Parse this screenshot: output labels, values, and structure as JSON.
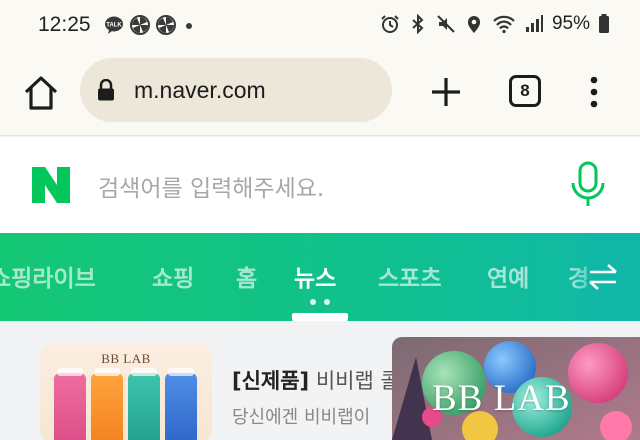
{
  "status_bar": {
    "time": "12:25",
    "left_icons": [
      "talk-icon",
      "pinwheel-icon",
      "pinwheel-icon",
      "dot-icon"
    ],
    "right_icons": [
      "alarm-icon",
      "bluetooth-icon",
      "mute-icon",
      "location-icon",
      "wifi-icon",
      "signal-icon",
      "battery-icon"
    ],
    "battery": "95%"
  },
  "browser": {
    "url": "m.naver.com",
    "tab_count": "8"
  },
  "search": {
    "logo": "N",
    "placeholder": "검색어를 입력해주세요."
  },
  "nav": {
    "items": [
      "쇼핑라이브",
      "쇼핑",
      "홈",
      "뉴스",
      "스포츠",
      "연예",
      "경"
    ],
    "active": "뉴스"
  },
  "content": {
    "thumb_brand": "BB LAB",
    "ad_prefix": "[신제품]",
    "ad_title_rest": " 비비랩 콜",
    "ad_desc": "당신에겐 비비랩이",
    "banner_text": "BB LAB"
  },
  "colors": {
    "naver_green": "#03c75a",
    "nav_gradient_start": "#14c774",
    "nav_gradient_end": "#11b8a8"
  }
}
